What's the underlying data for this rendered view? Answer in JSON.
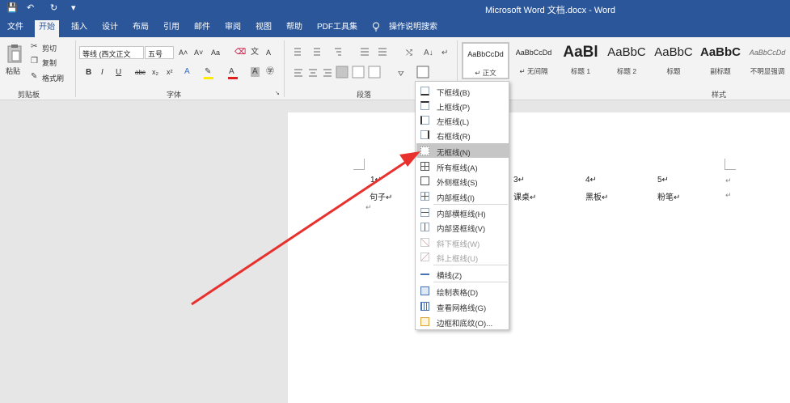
{
  "titlebar": {
    "title": "Microsoft Word 文档.docx - Word",
    "save_icon": "💾",
    "undo_icon": "↶",
    "redo_icon": "↻",
    "customize_icon": "▾"
  },
  "tabs": [
    {
      "label": "文件"
    },
    {
      "label": "开始"
    },
    {
      "label": "插入"
    },
    {
      "label": "设计"
    },
    {
      "label": "布局"
    },
    {
      "label": "引用"
    },
    {
      "label": "邮件"
    },
    {
      "label": "审阅"
    },
    {
      "label": "视图"
    },
    {
      "label": "帮助"
    },
    {
      "label": "PDF工具集"
    }
  ],
  "tell_me": "操作说明搜索",
  "clipboard": {
    "paste": "粘贴",
    "cut": "剪切",
    "copy": "复制",
    "format_painter": "格式刷",
    "group": "剪贴板"
  },
  "font": {
    "name": "等线 (西文正文",
    "size": "五号",
    "group": "字体",
    "row1": [
      "A˄",
      "A˅",
      "Aa",
      "A"
    ],
    "row2": [
      "B",
      "I",
      "U",
      "abc",
      "x₂",
      "x²"
    ]
  },
  "paragraph": {
    "group": "段落"
  },
  "styles": {
    "group": "样式",
    "items": [
      {
        "sample": "AaBbCcDd",
        "name": "↵ 正文"
      },
      {
        "sample": "AaBbCcDd",
        "name": "↵ 无间隔"
      },
      {
        "sample": "AaBl",
        "name": "标题 1"
      },
      {
        "sample": "AaBbC",
        "name": "标题 2"
      },
      {
        "sample": "AaBbC",
        "name": "标题"
      },
      {
        "sample": "AaBbC",
        "name": "副标题"
      },
      {
        "sample": "AaBbCcDd",
        "name": "不明显强调"
      }
    ]
  },
  "document": {
    "row1": [
      "1↵",
      "3↵",
      "4↵",
      "5↵",
      "↵"
    ],
    "row2": [
      "句子↵",
      "课桌↵",
      "黑板↵",
      "粉笔↵",
      "↵"
    ],
    "para_mark": "↵"
  },
  "border_menu": {
    "items": [
      {
        "label": "下框线(B)"
      },
      {
        "label": "上框线(P)"
      },
      {
        "label": "左框线(L)"
      },
      {
        "label": "右框线(R)"
      },
      {
        "label": "无框线(N)"
      },
      {
        "label": "所有框线(A)"
      },
      {
        "label": "外侧框线(S)"
      },
      {
        "label": "内部框线(I)"
      },
      {
        "label": "内部横框线(H)"
      },
      {
        "label": "内部竖框线(V)"
      },
      {
        "label": "斜下框线(W)"
      },
      {
        "label": "斜上框线(U)"
      },
      {
        "label": "横线(Z)"
      },
      {
        "label": "绘制表格(D)"
      },
      {
        "label": "查看网格线(G)"
      },
      {
        "label": "边框和底纹(O)..."
      }
    ]
  },
  "colors": {
    "titlebar": "#2b579a",
    "ribbon": "#f3f3f3",
    "arrow": "#e8312f",
    "highlight": "#c6c6c6"
  }
}
